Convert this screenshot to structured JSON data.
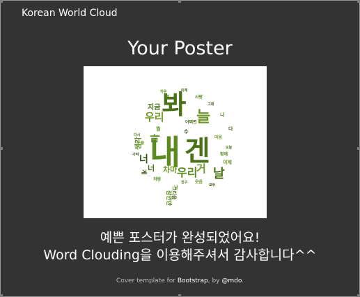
{
  "header": {
    "brand": "Korean World Cloud"
  },
  "main": {
    "title": "Your Poster",
    "message_line1": "예쁜 포스터가 완성되었어요!",
    "message_line2": "Word Clouding을 이용해주셔서 감사합니다^^"
  },
  "footer": {
    "prefix": "Cover template for ",
    "bootstrap": "Bootstrap",
    "middle": ", by ",
    "author": "@mdo",
    "suffix": "."
  },
  "poster": {
    "words": [
      "봐",
      "늘",
      "내",
      "겐",
      "우리",
      "지금",
      "생각",
      "너",
      "마",
      "거",
      "날",
      "우리",
      "차마",
      "게",
      "너",
      "나",
      "이제",
      "어쩌면",
      "수",
      "한",
      "다",
      "뭘"
    ],
    "colors": [
      "#5a8a1e",
      "#4a7018",
      "#6f9a2a",
      "#2f4f10"
    ]
  }
}
